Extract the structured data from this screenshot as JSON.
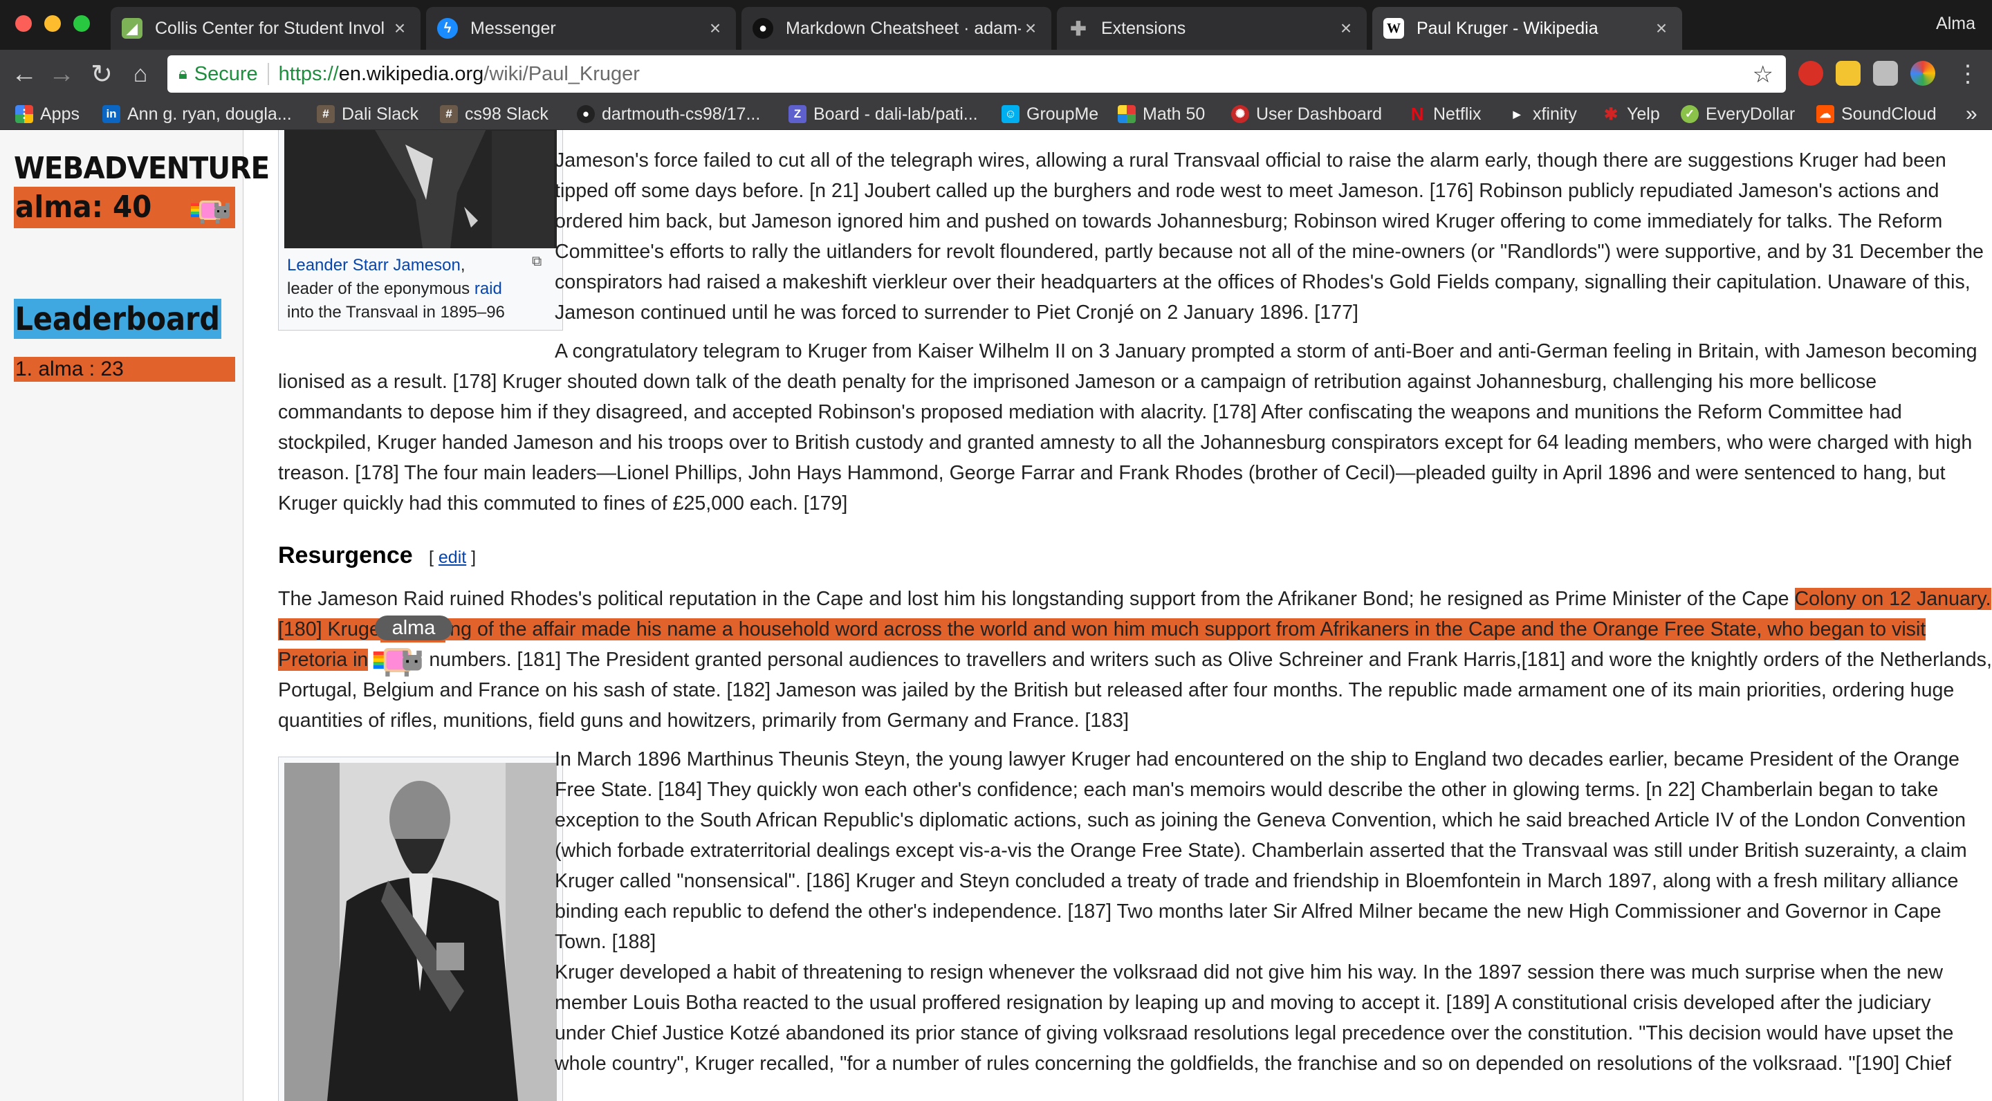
{
  "browser": {
    "tabs": [
      {
        "title": "Collis Center for Student Invol",
        "icon": "collis-icon",
        "active": false
      },
      {
        "title": "Messenger",
        "icon": "messenger-icon",
        "active": false
      },
      {
        "title": "Markdown Cheatsheet · adam-",
        "icon": "github-icon",
        "active": false
      },
      {
        "title": "Extensions",
        "icon": "puzzle-icon",
        "active": false
      },
      {
        "title": "Paul Kruger - Wikipedia",
        "icon": "wikipedia-icon",
        "active": true
      }
    ],
    "tab_close": "×",
    "profile_name": "Alma",
    "secure_label": "Secure",
    "url_proto": "https://",
    "url_host": "en.wikipedia.org",
    "url_path": "/wiki/Paul_Kruger",
    "bookmarks": [
      {
        "label": "Apps",
        "icon": "apps-grid-icon"
      },
      {
        "label": "Ann g. ryan, dougla...",
        "icon": "linkedin-icon"
      },
      {
        "label": "Dali Slack",
        "icon": "slack-icon"
      },
      {
        "label": "cs98 Slack",
        "icon": "slack-icon"
      },
      {
        "label": "dartmouth-cs98/17...",
        "icon": "github-icon"
      },
      {
        "label": "Board - dali-lab/pati...",
        "icon": "zenhub-icon"
      },
      {
        "label": "GroupMe",
        "icon": "groupme-icon"
      },
      {
        "label": "Math 50",
        "icon": "math-icon"
      },
      {
        "label": "User Dashboard",
        "icon": "dashboard-icon"
      },
      {
        "label": "Netflix",
        "icon": "netflix-icon"
      },
      {
        "label": "xfinity",
        "icon": "xfinity-icon"
      },
      {
        "label": "Yelp",
        "icon": "yelp-icon"
      },
      {
        "label": "EveryDollar",
        "icon": "everydollar-icon"
      },
      {
        "label": "SoundCloud",
        "icon": "soundcloud-icon"
      }
    ],
    "bookmarks_overflow": "»"
  },
  "game": {
    "title": "WEBADVENTURE",
    "score": "alma: 40",
    "leaderboard_title": "Leaderboard",
    "leaderboard_rows": [
      "1. alma : 23"
    ],
    "player_tag": "alma",
    "accent_color": "#e2622c",
    "leaderboard_color": "#40a8e0"
  },
  "article": {
    "caption_top": {
      "link1": "Leander Starr Jameson",
      "text1": ",",
      "text2": "leader of the eponymous ",
      "link2": "raid",
      "text3": "into the Transvaal in 1895–96"
    },
    "p1": [
      "Jameson's force failed to cut all of the telegraph wires, allowing a rural Transvaal official to raise the alarm early, though there are suggestions Kruger had been",
      "tipped off some days before. [n 21] Joubert called up the burghers and rode west to meet Jameson. [176] Robinson publicly repudiated Jameson's actions and",
      "ordered him back, but Jameson ignored him and pushed on towards Johannesburg; Robinson wired Kruger offering to come immediately for talks. The Reform",
      "Committee's efforts to rally the uitlanders for revolt floundered, partly because not all of the mine-owners (or \"Randlords\") were supportive, and by 31 December the",
      "conspirators had raised a makeshift vierkleur over their headquarters at the offices of Rhodes's Gold Fields company, signalling their capitulation. Unaware of this,",
      "Jameson continued until he was forced to surrender to Piet Cronjé on 2 January 1896. [177]"
    ],
    "p2": [
      "A congratulatory telegram to Kruger from Kaiser Wilhelm II on 3 January prompted a storm of anti-Boer and anti-German feeling in Britain, with Jameson becoming",
      "lionised as a result. [178] Kruger shouted down talk of the death penalty for the imprisoned Jameson or a campaign of retribution against Johannesburg, challenging his more bellicose",
      "commandants to depose him if they disagreed, and accepted Robinson's proposed mediation with alacrity. [178] After confiscating the weapons and munitions the Reform Committee had",
      "stockpiled, Kruger handed Jameson and his troops over to British custody and granted amnesty to all the Johannesburg conspirators except for 64 leading members, who were charged with high",
      "treason. [178] The four main leaders—Lionel Phillips, John Hays Hammond, George Farrar and Frank Rhodes (brother of Cecil)—pleaded guilty in April 1896 and were sentenced to hang, but",
      "Kruger quickly had this commuted to fines of £25,000 each. [179]"
    ],
    "section_title": "Resurgence",
    "edit_open": "[ ",
    "edit_label": "edit",
    "edit_close": " ]",
    "p3": {
      "l1_plain": "The Jameson Raid ruined Rhodes's political reputation in the Cape and lost him his longstanding support from the Afrikaner Bond; he resigned as Prime Minister of the Cape ",
      "l1_hl": "Colony on 12 January.",
      "l2_hl_a": "[180] Kruge",
      "l2_hl_b": "ing of the affair made his name a household word across the world and won him much support from Afrikaners in the Cape and the Orange Free State, who began to visit",
      "l3_hl": "Pretoria in",
      "l3_plain": "numbers. [181] The President granted personal audiences to travellers and writers such as Olive Schreiner and Frank Harris,[181] and wore the knightly orders of the Netherlands,",
      "l4": "Portugal, Belgium and France on his sash of state. [182] Jameson was jailed by the British but released after four months. The republic made armament one of its main priorities, ordering huge",
      "l5": "quantities of rifles, munitions, field guns and howitzers, primarily from Germany and France. [183]"
    },
    "p4": [
      "In March 1896 Marthinus Theunis Steyn, the young lawyer Kruger had encountered on the ship to England two decades earlier, became President of the Orange",
      "Free State. [184] They quickly won each other's confidence; each man's memoirs would describe the other in glowing terms. [n 22] Chamberlain began to take",
      "exception to the South African Republic's diplomatic actions, such as joining the Geneva Convention, which he said breached Article IV of the London Convention",
      "(which forbade extraterritorial dealings except vis-a-vis the Orange Free State). Chamberlain asserted that the Transvaal was still under British suzerainty, a claim",
      "Kruger called \"nonsensical\". [186] Kruger and Steyn concluded a treaty of trade and friendship in Bloemfontein in March 1897, along with a fresh military alliance",
      "binding each republic to defend the other's independence. [187] Two months later Sir Alfred Milner became the new High Commissioner and Governor in Cape",
      "Town. [188]"
    ],
    "p5": [
      "Kruger developed a habit of threatening to resign whenever the volksraad did not give him his way. In the 1897 session there was much surprise when the new",
      "member Louis Botha reacted to the usual proffered resignation by leaping up and moving to accept it. [189] A constitutional crisis developed after the judiciary",
      "under Chief Justice Kotzé abandoned its prior stance of giving volksraad resolutions legal precedence over the constitution. \"This decision would have upset the",
      "whole country\", Kruger recalled, \"for a number of rules concerning the goldfields, the franchise and so on depended on resolutions of the volksraad. \"[190] Chief"
    ]
  }
}
